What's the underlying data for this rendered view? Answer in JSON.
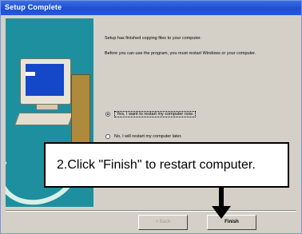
{
  "window": {
    "title": "Setup Complete"
  },
  "content": {
    "line1": "Setup has finished copying files to your computer.",
    "line2": "Before you can use the program, you must restart Windows or your computer."
  },
  "options": [
    {
      "label": "Yes, I want to restart my computer now.",
      "selected": true
    },
    {
      "label": "No, I will restart my computer later.",
      "selected": false
    }
  ],
  "buttons": {
    "back": "< Back",
    "finish": "Finish"
  },
  "annotation": {
    "text": "2.Click \"Finish\" to restart computer."
  }
}
